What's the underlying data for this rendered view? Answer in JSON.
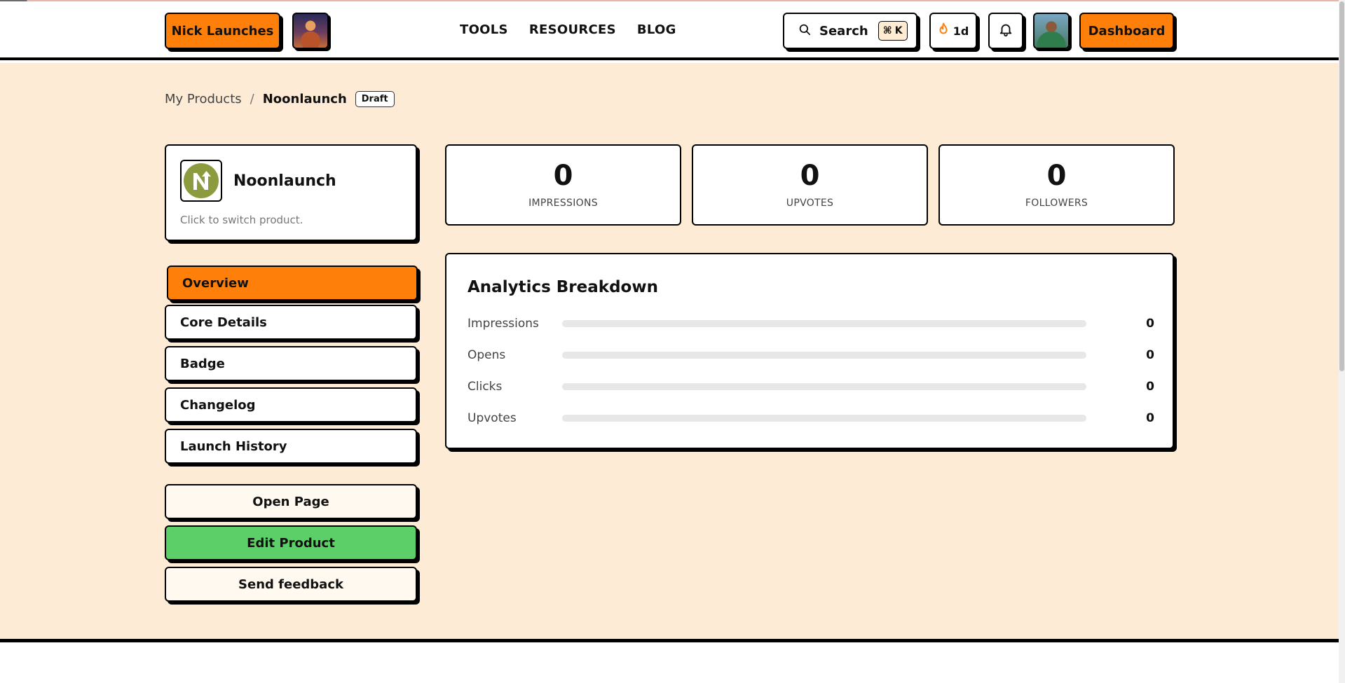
{
  "header": {
    "brand_label": "Nick Launches",
    "nav": [
      "TOOLS",
      "RESOURCES",
      "BLOG"
    ],
    "search_label": "Search",
    "search_shortcut_key": "K",
    "streak_label": "1d",
    "dashboard_label": "Dashboard"
  },
  "breadcrumb": {
    "parent": "My Products",
    "separator": "/",
    "current": "Noonlaunch",
    "status_badge": "Draft"
  },
  "product": {
    "name": "Noonlaunch",
    "hint": "Click to switch product."
  },
  "sidebar": {
    "items": [
      {
        "label": "Overview",
        "active": true
      },
      {
        "label": "Core Details",
        "active": false
      },
      {
        "label": "Badge",
        "active": false
      },
      {
        "label": "Changelog",
        "active": false
      },
      {
        "label": "Launch History",
        "active": false
      }
    ],
    "actions": {
      "open_page": "Open Page",
      "edit_product": "Edit Product",
      "send_feedback": "Send feedback"
    }
  },
  "stats": [
    {
      "value": "0",
      "label": "IMPRESSIONS"
    },
    {
      "value": "0",
      "label": "UPVOTES"
    },
    {
      "value": "0",
      "label": "FOLLOWERS"
    }
  ],
  "breakdown": {
    "title": "Analytics Breakdown",
    "rows": [
      {
        "label": "Impressions",
        "value": "0",
        "fill": 0
      },
      {
        "label": "Opens",
        "value": "0",
        "fill": 0
      },
      {
        "label": "Clicks",
        "value": "0",
        "fill": 0
      },
      {
        "label": "Upvotes",
        "value": "0",
        "fill": 0
      }
    ]
  },
  "colors": {
    "accent": "#ff7f0b",
    "background": "#feebd5",
    "success": "#5ccf68"
  },
  "icons": [
    "search-icon",
    "flame-icon",
    "bell-icon",
    "noonlaunch-logo-icon"
  ]
}
